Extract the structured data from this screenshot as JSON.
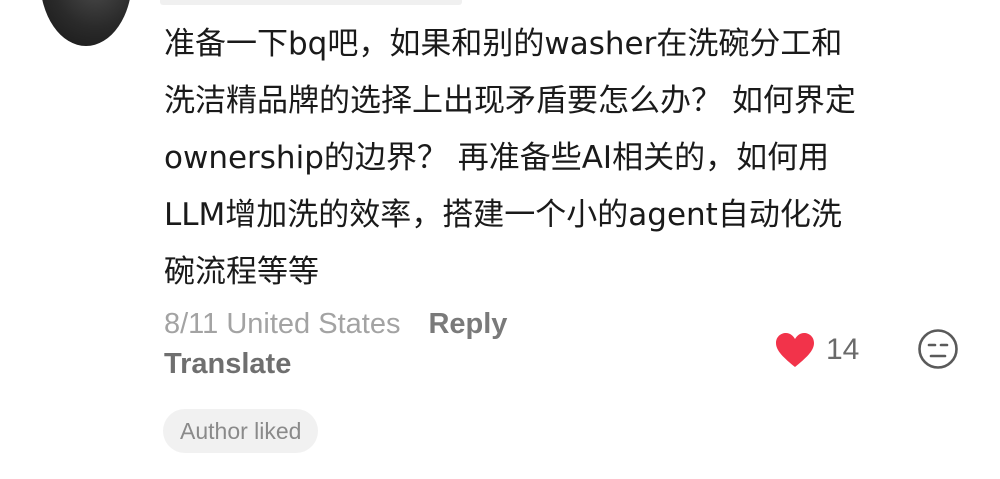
{
  "comment": {
    "text": "准备一下bq吧，如果和别的washer在洗碗分工和\n洗洁精品牌的选择上出现矛盾要怎么办？ 如何界定\nownership的边界？ 再准备些AI相关的，如何用\nLLM增加洗的效率，搭建一个小的agent自动化洗\n碗流程等等",
    "date_location": "8/11 United States",
    "reply_label": "Reply",
    "translate_label": "Translate",
    "author_liked_label": "Author liked",
    "like_count": "14"
  },
  "icons": {
    "like": "heart-icon",
    "dislike": "unamused-face-icon"
  },
  "colors": {
    "heart": "#f2334a",
    "meta_gray": "#a3a3a3",
    "badge_bg": "#f1f1f1"
  }
}
